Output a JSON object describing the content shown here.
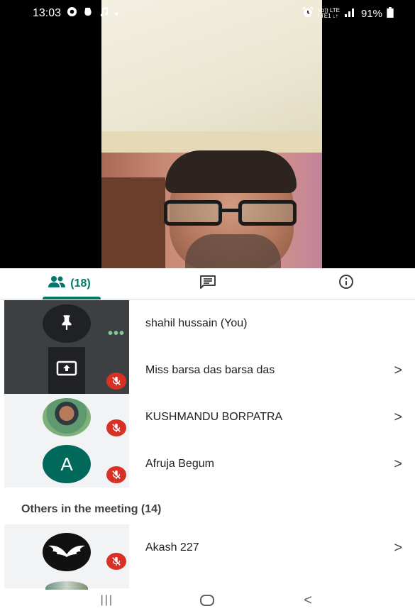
{
  "status_bar": {
    "time": "13:03",
    "battery": "91%",
    "network_top": "Vo)) LTE",
    "network_bottom": "LTE1 ↓↑",
    "signal": ".ıl"
  },
  "tabs": [
    {
      "id": "people",
      "icon": "people-icon",
      "label": "(18)",
      "selected": true
    },
    {
      "id": "chat",
      "icon": "chat-icon",
      "selected": false
    },
    {
      "id": "info",
      "icon": "info-icon",
      "selected": false
    }
  ],
  "participants": [
    {
      "name": "shahil hussain (You)",
      "avatar": "pin-icon",
      "status": "speaking-dots",
      "has_chevron": false
    },
    {
      "name": "Miss barsa das barsa das",
      "avatar": "screen-share-icon",
      "status": "muted",
      "has_chevron": true
    },
    {
      "name": "KUSHMANDU BORPATRA",
      "avatar": "photo",
      "status": "muted",
      "has_chevron": true
    },
    {
      "name": "Afruja Begum",
      "avatar": "A",
      "status": "muted",
      "has_chevron": true
    }
  ],
  "others_section": {
    "title": "Others in the meeting (14)",
    "items": [
      {
        "name": "Akash 227",
        "avatar": "wings-photo",
        "status": "muted",
        "has_chevron": true
      }
    ]
  },
  "colors": {
    "accent": "#00796b",
    "mute_red": "#d93025",
    "avatar_teal": "#00695c",
    "tile_dark": "#3c4043",
    "tile_light": "#f1f3f4"
  },
  "nav_bar": {
    "recents": "|||",
    "home": "○",
    "back": "<"
  }
}
